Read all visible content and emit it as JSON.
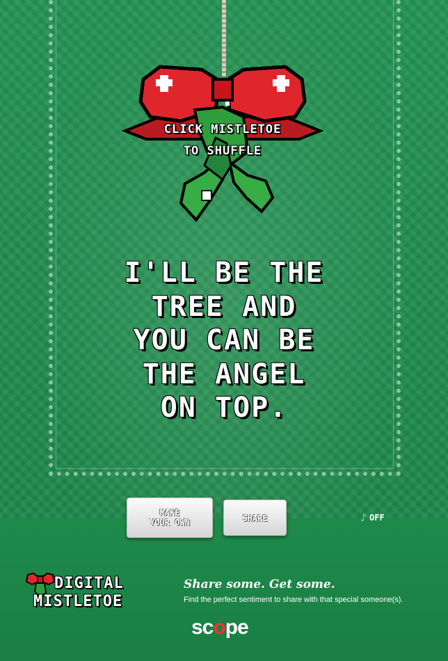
{
  "mistletoe": {
    "instruction_line1": "CLICK MISTLETOE",
    "instruction_line2": "TO SHUFFLE"
  },
  "quote": {
    "text": "I'LL BE THE\nTREE AND\nYOU CAN BE\nTHE ANGEL\nON TOP."
  },
  "buttons": {
    "make_line1": "MAKE",
    "make_line2": "YOUR OWN",
    "share": "SHARE"
  },
  "sound": {
    "icon": "music-note-icon",
    "label": "OFF"
  },
  "footer": {
    "logo_line1": "DIGITAL",
    "logo_line2": "MISTLETOE",
    "tagline": "Share some. Get some.",
    "subline": "Find the perfect sentiment to share with that special someone(s).",
    "brand_pre": "sc",
    "brand_o": "o",
    "brand_post": "pe"
  },
  "colors": {
    "background": "#1f8c4c",
    "bow_red": "#e0262d",
    "leaf_green": "#2f9e3c",
    "button": "#e8e8e8"
  }
}
